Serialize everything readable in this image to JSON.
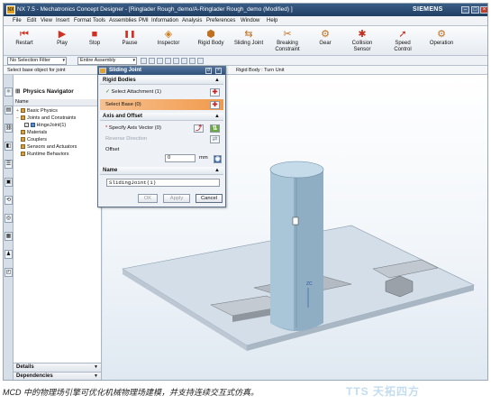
{
  "window": {
    "title": "NX 7.5 - Mechatronics Concept Designer - [Ringlader Rough_demo/A-Ringlader Rough_demo (Modified) ]",
    "brand": "SIEMENS",
    "app_icon": "NX"
  },
  "menu": [
    "File",
    "Edit",
    "View",
    "Insert",
    "Format",
    "Tools",
    "Assemblies",
    "PMI",
    "Information",
    "Analysis",
    "Preferences",
    "Window",
    "Help"
  ],
  "toolbar": [
    {
      "label": "Restart",
      "icon": "restart-icon",
      "glyph": "⏮",
      "color": "#d03020"
    },
    {
      "label": "Play",
      "icon": "play-icon",
      "glyph": "▶",
      "color": "#d03020"
    },
    {
      "label": "Stop",
      "icon": "stop-icon",
      "glyph": "■",
      "color": "#d03020"
    },
    {
      "label": "Pause",
      "icon": "pause-icon",
      "glyph": "❚❚",
      "color": "#d03020"
    },
    {
      "label": "Inspector",
      "icon": "inspector-icon",
      "glyph": "◈",
      "color": "#d08020"
    },
    {
      "label": "Rigid Body",
      "icon": "rigid-body-icon",
      "glyph": "⬢",
      "color": "#c07020"
    },
    {
      "label": "Sliding Joint",
      "icon": "sliding-joint-icon",
      "glyph": "⇆",
      "color": "#c07020"
    },
    {
      "label": "Breaking Constraint",
      "icon": "breaking-constraint-icon",
      "glyph": "✂",
      "color": "#c07020"
    },
    {
      "label": "Gear",
      "icon": "gear-icon",
      "glyph": "⚙",
      "color": "#c07020"
    },
    {
      "label": "Collision Sensor",
      "icon": "collision-sensor-icon",
      "glyph": "✱",
      "color": "#c03020"
    },
    {
      "label": "Speed Control",
      "icon": "speed-control-icon",
      "glyph": "➚",
      "color": "#c03020"
    },
    {
      "label": "Operation",
      "icon": "operation-icon",
      "glyph": "⚙",
      "color": "#c07020"
    }
  ],
  "filterbar": {
    "selection_filter": "No Selection Filter",
    "assembly_scope": "Entire Assembly"
  },
  "statusbar": {
    "left": "Select base object for joint",
    "right": "Rigid Body : Turn Unit"
  },
  "navigator": {
    "title": "Physics Navigator",
    "column": "Name",
    "tree": [
      {
        "label": "Basic Physics",
        "level": 0,
        "expand": "+",
        "kind": "folder"
      },
      {
        "label": "Joints and Constraints",
        "level": 0,
        "expand": "−",
        "kind": "folder"
      },
      {
        "label": "HingeJoint(1)",
        "level": 1,
        "expand": "",
        "kind": "joint"
      },
      {
        "label": "Materials",
        "level": 0,
        "expand": "",
        "kind": "folder"
      },
      {
        "label": "Couplers",
        "level": 0,
        "expand": "",
        "kind": "folder"
      },
      {
        "label": "Sensors and Actuators",
        "level": 0,
        "expand": "",
        "kind": "folder"
      },
      {
        "label": "Runtime Behaviors",
        "level": 0,
        "expand": "",
        "kind": "folder"
      }
    ],
    "details": "Details",
    "dependencies": "Dependencies"
  },
  "dialog": {
    "title": "Sliding Joint",
    "rigid_bodies_section": "Rigid Bodies",
    "select_attachment": "Select Attachment (1)",
    "select_base": "Select Base (0)",
    "axis_section": "Axis and Offset",
    "specify_axis": "Specify Axis Vector (0)",
    "reverse_direction": "Reverse Direction",
    "offset_label": "Offset",
    "offset_value": "0",
    "offset_unit": "mm",
    "name_section": "Name",
    "name_value": "SlidingJoint(1)",
    "ok": "OK",
    "apply": "Apply",
    "cancel": "Cancel"
  },
  "viewport": {
    "axis_label": "ZC"
  },
  "caption": "MCD 中的物理场引擎可优化机械物理场建模，并支持连续交互式仿真。",
  "watermark": "TTS 天拓四方"
}
